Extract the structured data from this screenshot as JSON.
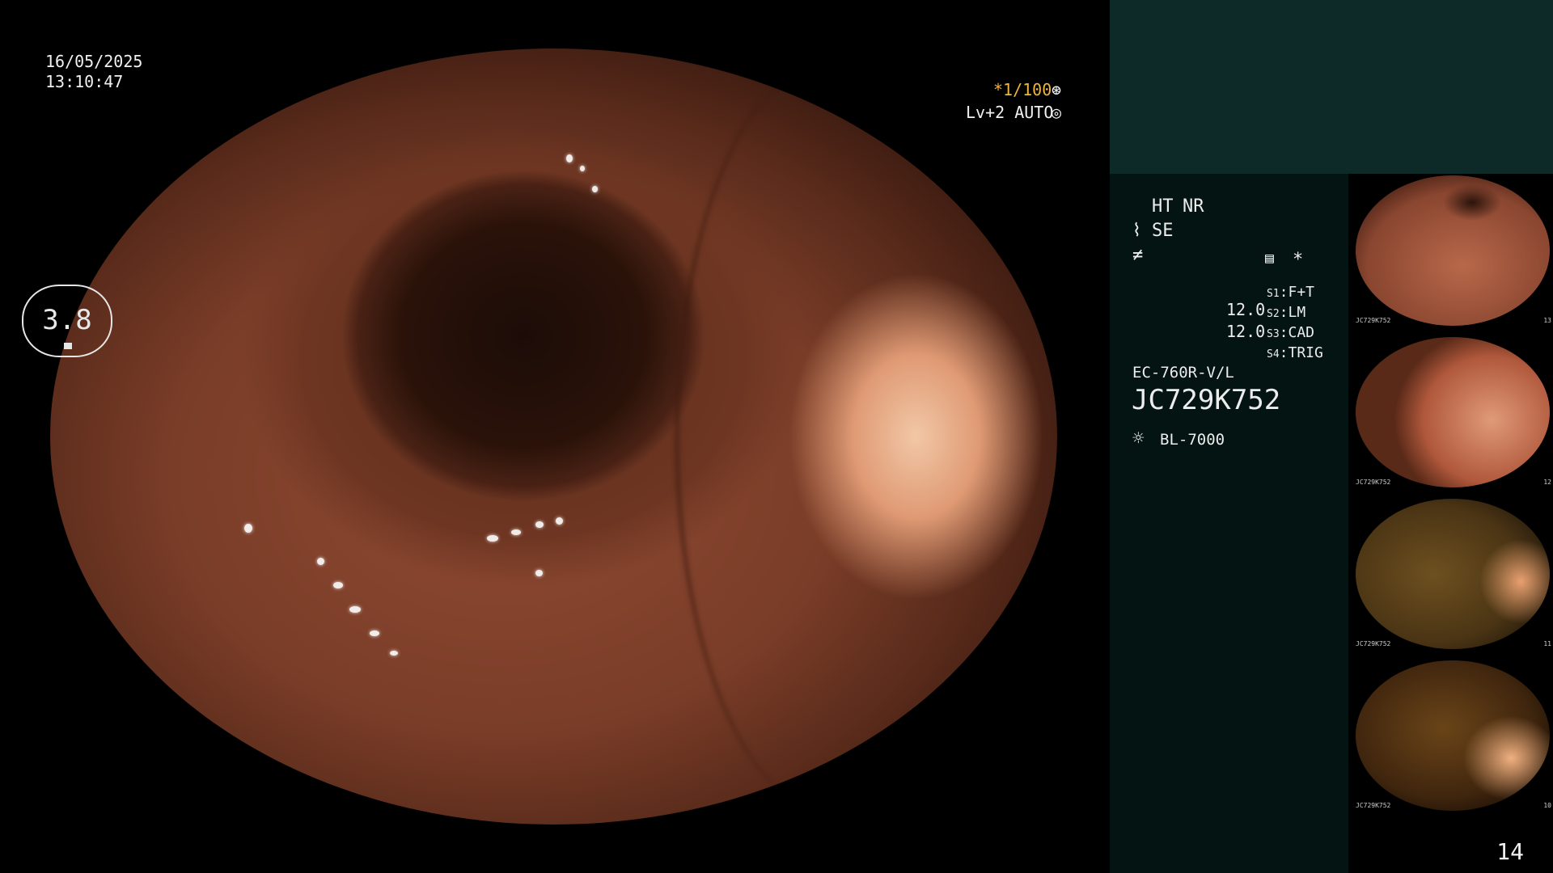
{
  "overlay": {
    "date": "16/05/2025",
    "time": "13:10:47",
    "shutter": "*1/100",
    "shutter_icon": "iris-icon",
    "level": "Lv+2 AUTO",
    "level_icon": "auto-iris-icon"
  },
  "panel": {
    "ht": "HT",
    "nr": "NR",
    "se": "SE",
    "se_icon": "enhance-icon",
    "freeze_icon": "freeze-icon",
    "memo_icon": "memo-icon",
    "asterisk": "*",
    "ring_value": "3.8",
    "values": [
      "12.0",
      "12.0"
    ],
    "switches": [
      {
        "key": "S1",
        "label": "F+T"
      },
      {
        "key": "S2",
        "label": "LM"
      },
      {
        "key": "S3",
        "label": "CAD"
      },
      {
        "key": "S4",
        "label": "TRIG"
      }
    ],
    "scope_model": "EC-760R-V/L",
    "serial": "JC729K752",
    "light_icon": "light-source-icon",
    "light_source": "BL-7000"
  },
  "thumbnails": [
    {
      "caption": "JC729K752",
      "number": "13"
    },
    {
      "caption": "JC729K752",
      "number": "12"
    },
    {
      "caption": "JC729K752",
      "number": "11"
    },
    {
      "caption": "JC729K752",
      "number": "10"
    }
  ],
  "page_number": "14",
  "colors": {
    "accent": "#f0b43c",
    "panel_top": "#0d2a28",
    "panel_info": "#041412"
  }
}
